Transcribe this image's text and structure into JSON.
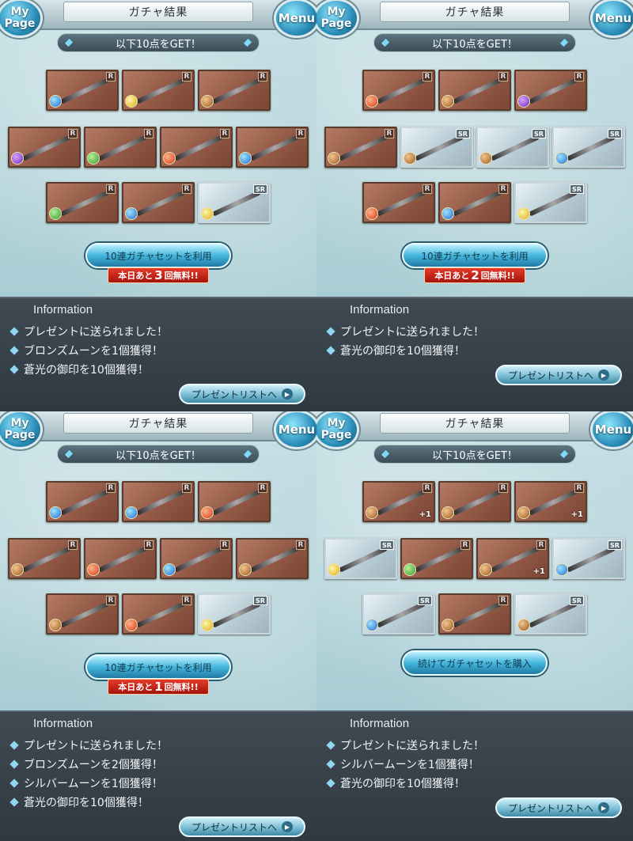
{
  "header": {
    "mypage_label": "My Page",
    "menu_label": "Menu",
    "title": "ガチャ結果"
  },
  "common": {
    "get_banner": "以下10点をGET！",
    "gacha_set_button": "10連ガチャセットを利用",
    "buy_set_button": "続けてガチャセットを購入",
    "info_title": "Information",
    "present_list_button": "プレゼントリストへ",
    "free_prefix": "本日あと",
    "free_suffix": "回無料!!"
  },
  "panels": [
    {
      "free_count": "3",
      "items": [
        {
          "rank": "R",
          "element": "water"
        },
        {
          "rank": "R",
          "element": "light"
        },
        {
          "rank": "R",
          "element": "earth"
        },
        {
          "rank": "R",
          "element": "dark"
        },
        {
          "rank": "R",
          "element": "wind"
        },
        {
          "rank": "R",
          "element": "fire"
        },
        {
          "rank": "R",
          "element": "water"
        },
        {
          "rank": "R",
          "element": "wind"
        },
        {
          "rank": "R",
          "element": "water"
        },
        {
          "rank": "SR",
          "element": "light"
        }
      ],
      "info": [
        "プレゼントに送られました！",
        "ブロンズムーンを1個獲得！",
        "蒼光の御印を10個獲得！"
      ]
    },
    {
      "free_count": "2",
      "items": [
        {
          "rank": "R",
          "element": "fire"
        },
        {
          "rank": "R",
          "element": "earth"
        },
        {
          "rank": "R",
          "element": "dark"
        },
        {
          "rank": "R",
          "element": "earth"
        },
        {
          "rank": "SR",
          "element": "earth"
        },
        {
          "rank": "SR",
          "element": "earth"
        },
        {
          "rank": "SR",
          "element": "water"
        },
        {
          "rank": "R",
          "element": "fire"
        },
        {
          "rank": "R",
          "element": "water"
        },
        {
          "rank": "SR",
          "element": "light"
        }
      ],
      "info": [
        "プレゼントに送られました！",
        "蒼光の御印を10個獲得！"
      ]
    },
    {
      "free_count": "1",
      "items": [
        {
          "rank": "R",
          "element": "water"
        },
        {
          "rank": "R",
          "element": "water"
        },
        {
          "rank": "R",
          "element": "fire"
        },
        {
          "rank": "R",
          "element": "earth"
        },
        {
          "rank": "R",
          "element": "fire"
        },
        {
          "rank": "R",
          "element": "water"
        },
        {
          "rank": "R",
          "element": "earth"
        },
        {
          "rank": "R",
          "element": "earth"
        },
        {
          "rank": "R",
          "element": "fire"
        },
        {
          "rank": "SR",
          "element": "light"
        }
      ],
      "info": [
        "プレゼントに送られました！",
        "ブロンズムーンを2個獲得！",
        "シルバームーンを1個獲得！",
        "蒼光の御印を10個獲得！"
      ]
    },
    {
      "free_count": "",
      "items": [
        {
          "rank": "R",
          "element": "earth",
          "plus": "+1"
        },
        {
          "rank": "R",
          "element": "earth"
        },
        {
          "rank": "R",
          "element": "earth",
          "plus": "+1"
        },
        {
          "rank": "SR",
          "element": "light"
        },
        {
          "rank": "R",
          "element": "wind"
        },
        {
          "rank": "R",
          "element": "earth",
          "plus": "+1"
        },
        {
          "rank": "SR",
          "element": "water"
        },
        {
          "rank": "SR",
          "element": "water"
        },
        {
          "rank": "R",
          "element": "earth"
        },
        {
          "rank": "SR",
          "element": "earth"
        }
      ],
      "info": [
        "プレゼントに送られました！",
        "シルバームーンを1個獲得！",
        "蒼光の御印を10個獲得！"
      ]
    }
  ]
}
